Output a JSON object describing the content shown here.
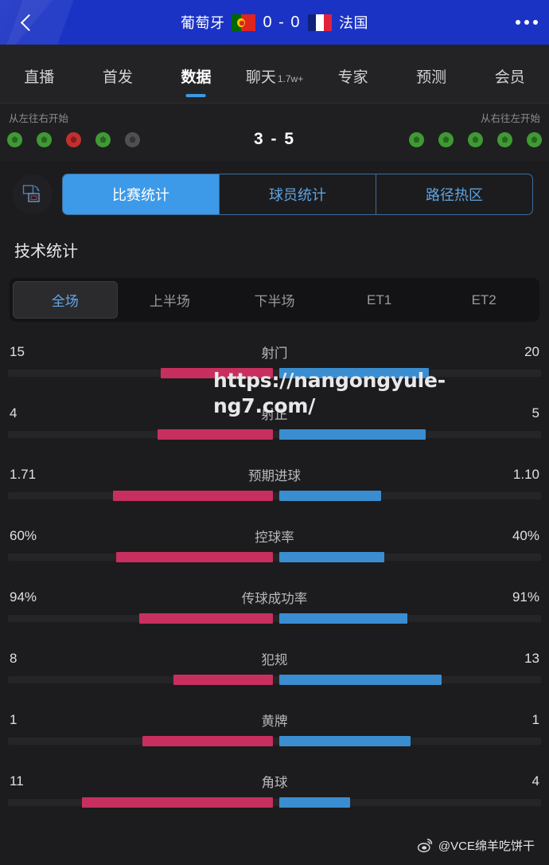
{
  "header": {
    "back_icon": "chevron-left-icon",
    "home_team": "葡萄牙",
    "away_team": "法国",
    "score": "0 - 0",
    "more_icon": "more-horizontal-icon",
    "home_flag": "portugal-flag",
    "away_flag": "france-flag",
    "background_color": "#1b33c4"
  },
  "nav": {
    "items": [
      {
        "label": "直播",
        "badge": "",
        "active": false
      },
      {
        "label": "首发",
        "badge": "",
        "active": false
      },
      {
        "label": "数据",
        "badge": "",
        "active": true
      },
      {
        "label": "聊天",
        "badge": "1.7w+",
        "active": false
      },
      {
        "label": "专家",
        "badge": "",
        "active": false
      },
      {
        "label": "预测",
        "badge": "",
        "active": false
      },
      {
        "label": "会员",
        "badge": "",
        "active": false
      }
    ],
    "active_color": "#3d9ae8"
  },
  "penalties": {
    "left_label": "从左往右开始",
    "right_label": "从右往左开始",
    "score": "3 - 5",
    "home_kicks": [
      "scored",
      "scored",
      "missed",
      "scored",
      "none"
    ],
    "away_kicks": [
      "scored",
      "scored",
      "scored",
      "scored",
      "scored"
    ],
    "colors": {
      "scored": "#3f9a34",
      "missed": "#c32f2f",
      "none": "#4f4f52"
    }
  },
  "view_tabs": {
    "pitch_icon": "pitch-rotate-icon",
    "items": [
      {
        "label": "比赛统计",
        "active": true
      },
      {
        "label": "球员统计",
        "active": false
      },
      {
        "label": "路径热区",
        "active": false
      }
    ],
    "accent": "#3d9ae8"
  },
  "section": {
    "title": "技术统计"
  },
  "periods": {
    "items": [
      {
        "label": "全场",
        "active": true
      },
      {
        "label": "上半场",
        "active": false
      },
      {
        "label": "下半场",
        "active": false
      },
      {
        "label": "ET1",
        "active": false
      },
      {
        "label": "ET2",
        "active": false
      }
    ]
  },
  "chart_data": {
    "type": "bar",
    "title": "技术统计",
    "orientation": "horizontal-diverging",
    "home_color": "#c72f5e",
    "away_color": "#3a8dd0",
    "series": [
      {
        "name": "葡萄牙",
        "color": "#c72f5e"
      },
      {
        "name": "法国",
        "color": "#3a8dd0"
      }
    ],
    "categories": [
      "射门",
      "射正",
      "预期进球",
      "控球率",
      "传球成功率",
      "犯规",
      "黄牌",
      "角球"
    ],
    "rows": [
      {
        "label": "射门",
        "home": "15",
        "away": "20",
        "home_pct": 43,
        "away_pct": 57
      },
      {
        "label": "射正",
        "home": "4",
        "away": "5",
        "home_pct": 44,
        "away_pct": 56
      },
      {
        "label": "预期进球",
        "home": "1.71",
        "away": "1.10",
        "home_pct": 61,
        "away_pct": 39
      },
      {
        "label": "控球率",
        "home": "60%",
        "away": "40%",
        "home_pct": 60,
        "away_pct": 40
      },
      {
        "label": "传球成功率",
        "home": "94%",
        "away": "91%",
        "home_pct": 51,
        "away_pct": 49
      },
      {
        "label": "犯规",
        "home": "8",
        "away": "13",
        "home_pct": 38,
        "away_pct": 62
      },
      {
        "label": "黄牌",
        "home": "1",
        "away": "1",
        "home_pct": 50,
        "away_pct": 50
      },
      {
        "label": "角球",
        "home": "11",
        "away": "4",
        "home_pct": 73,
        "away_pct": 27
      }
    ]
  },
  "watermarks": {
    "url": "https://nangongyule-ng7.com/",
    "signature": "@VCE绵羊吃饼干",
    "weibo_icon": "weibo-icon"
  }
}
